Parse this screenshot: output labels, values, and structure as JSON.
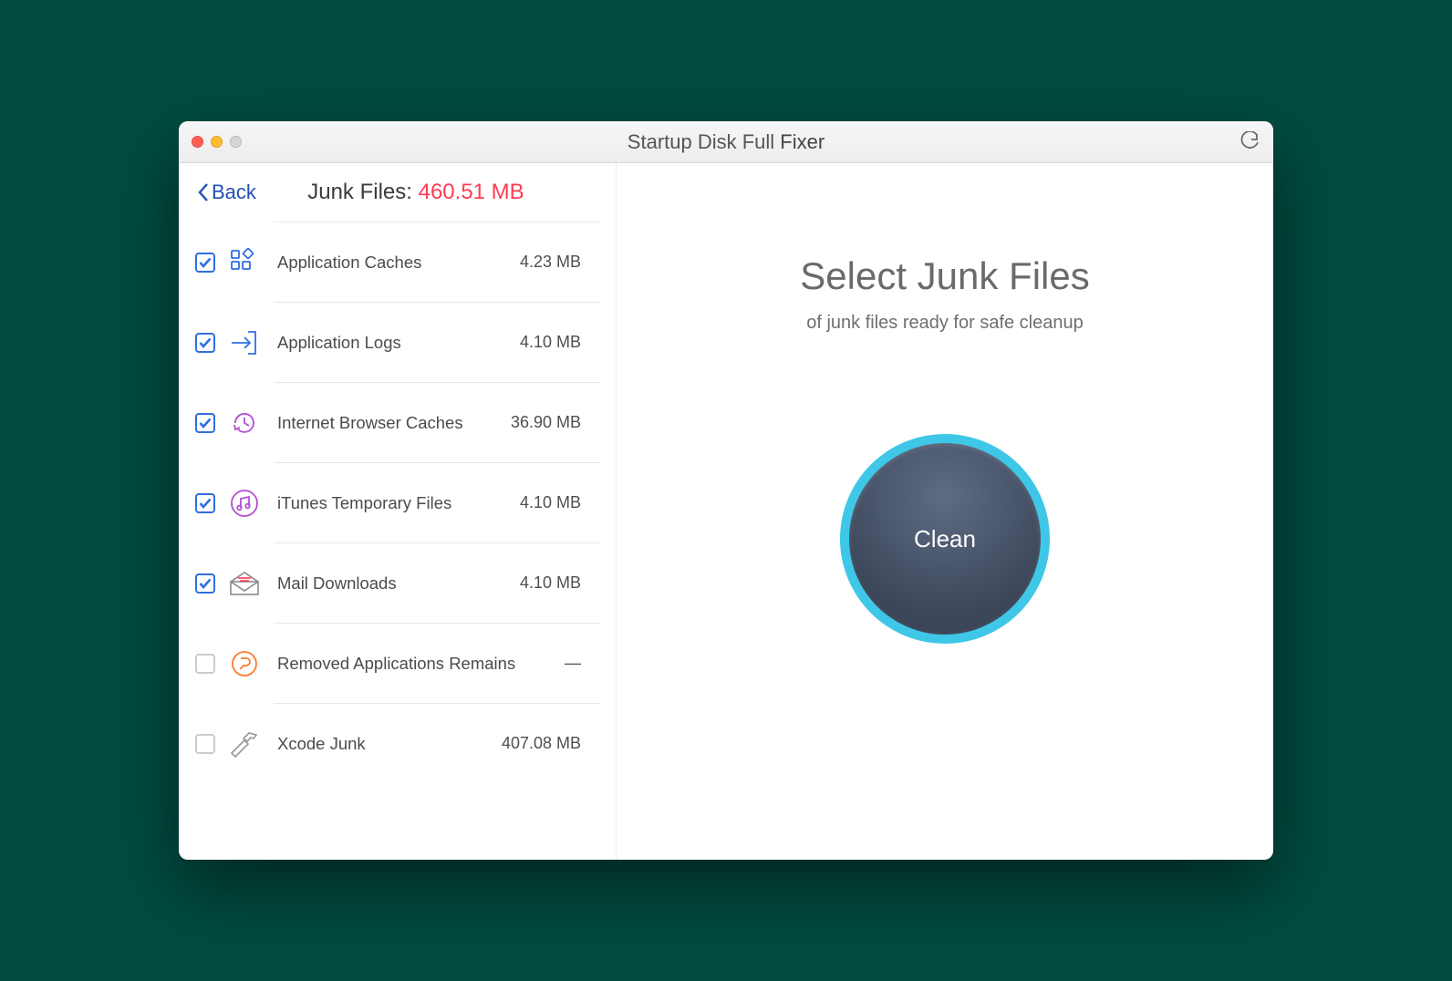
{
  "window": {
    "title_light": "Startup Disk Full ",
    "title_bold": "Fixer"
  },
  "sidebar": {
    "back_label": "Back",
    "header_prefix": "Junk Files: ",
    "header_size": "460.51 MB",
    "categories": [
      {
        "name": "Application Caches",
        "size": "4.23 MB",
        "checked": true
      },
      {
        "name": "Application Logs",
        "size": "4.10 MB",
        "checked": true
      },
      {
        "name": "Internet Browser Caches",
        "size": "36.90 MB",
        "checked": true
      },
      {
        "name": "iTunes Temporary Files",
        "size": "4.10 MB",
        "checked": true
      },
      {
        "name": "Mail Downloads",
        "size": "4.10 MB",
        "checked": true
      },
      {
        "name": "Removed Applications Remains",
        "size": "—",
        "checked": false
      },
      {
        "name": "Xcode Junk",
        "size": "407.08 MB",
        "checked": false
      }
    ]
  },
  "main": {
    "heading": "Select Junk Files",
    "subtitle": "of junk files ready for safe cleanup",
    "clean_label": "Clean"
  }
}
